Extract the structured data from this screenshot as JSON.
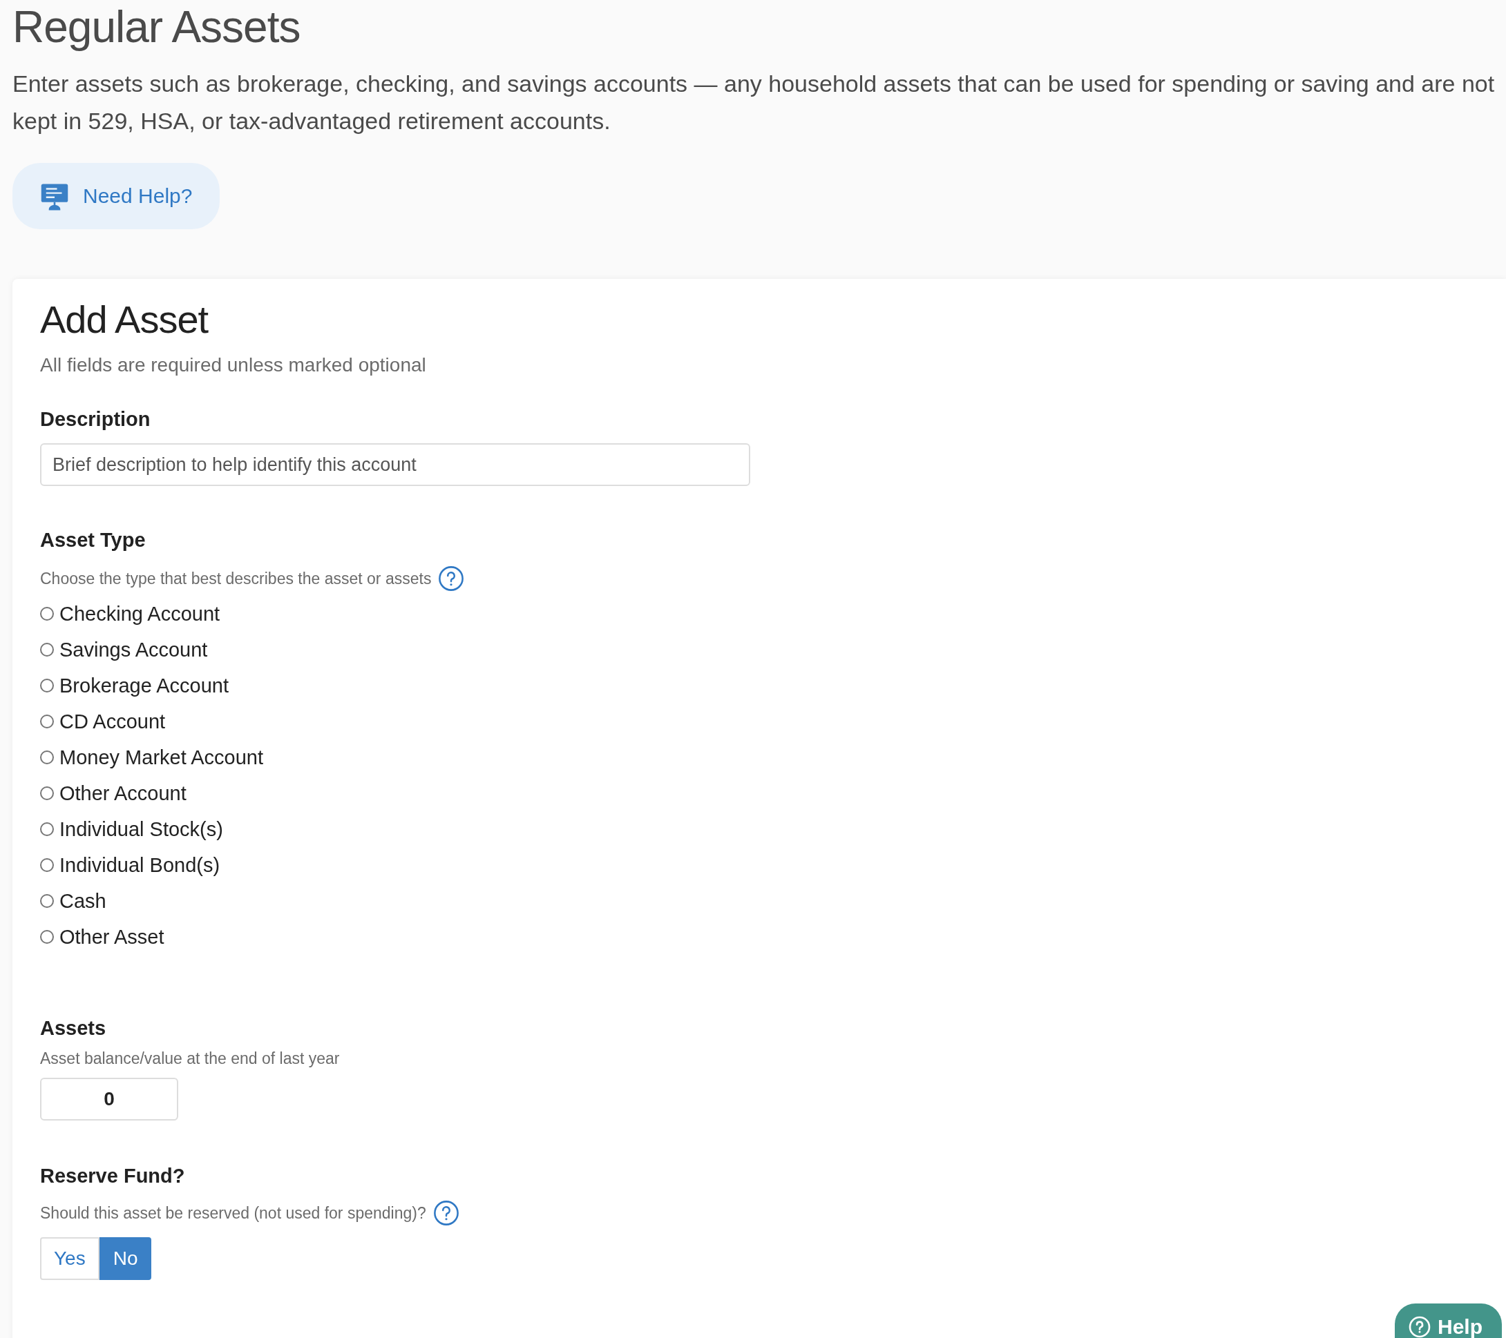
{
  "page": {
    "title": "Regular Assets",
    "intro": "Enter assets such as brokerage, checking, and savings accounts — any household assets that can be used for spending or saving and are not kept in 529, HSA, or tax-advantaged retirement accounts.",
    "help_button": "Need Help?"
  },
  "form": {
    "title": "Add Asset",
    "subtitle": "All fields are required unless marked optional",
    "description": {
      "label": "Description",
      "placeholder": "Brief description to help identify this account"
    },
    "asset_type": {
      "label": "Asset Type",
      "hint": "Choose the type that best describes the asset or assets",
      "options": [
        {
          "label": "Checking Account",
          "selected": false
        },
        {
          "label": "Savings Account",
          "selected": false
        },
        {
          "label": "Brokerage Account",
          "selected": false
        },
        {
          "label": "CD Account",
          "selected": false
        },
        {
          "label": "Money Market Account",
          "selected": false
        },
        {
          "label": "Other Account",
          "selected": false
        },
        {
          "label": "Individual Stock(s)",
          "selected": false
        },
        {
          "label": "Individual Bond(s)",
          "selected": false
        },
        {
          "label": "Cash",
          "selected": false
        },
        {
          "label": "Other Asset",
          "selected": false
        }
      ]
    },
    "assets": {
      "label": "Assets",
      "hint": "Asset balance/value at the end of last year",
      "value": "0"
    },
    "reserve_fund": {
      "label": "Reserve Fund?",
      "hint": "Should this asset be reserved (not used for spending)?",
      "options": [
        {
          "label": "Yes",
          "selected": false
        },
        {
          "label": "No",
          "selected": true
        }
      ]
    }
  },
  "floating_help": {
    "label": "Help"
  }
}
